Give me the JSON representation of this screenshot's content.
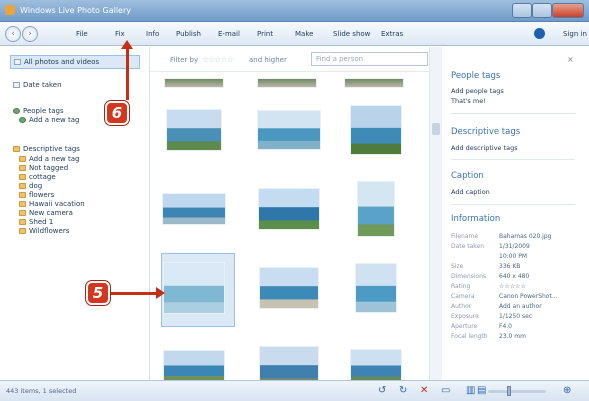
{
  "window": {
    "title": "Windows Live Photo Gallery"
  },
  "toolbar": {
    "menu": [
      "File",
      "Fix",
      "Info",
      "Publish",
      "E-mail",
      "Print",
      "Make",
      "Slide show",
      "Extras"
    ],
    "sign_in": "Sign in"
  },
  "sidebar": {
    "all_photos": "All photos and videos",
    "date_taken": "Date taken",
    "people_tags": "People tags",
    "add_new_tag_people": "Add a new tag",
    "descriptive_tags": "Descriptive tags",
    "descriptive_items": [
      "Add a new tag",
      "Not tagged",
      "cottage",
      "dog",
      "flowers",
      "Hawaii vacation",
      "New camera",
      "Shed 1",
      "Wildflowers"
    ]
  },
  "filter": {
    "label": "Filter by",
    "and_label": "and higher",
    "search_placeholder": "Find a person"
  },
  "thumbnails": [
    {
      "sky": "#c7dcee",
      "sea": "#4a8fb6",
      "land": "#5e8a4d"
    },
    {
      "sky": "#d2e4f2",
      "sea": "#4a97c0",
      "land": "#7fb1c9"
    },
    {
      "sky": "#b9d3ea",
      "sea": "#3f8bb8",
      "land": "#4f7c3c"
    },
    {
      "sky": "#bfd8ee",
      "sea": "#3d86b3",
      "land": "#9bb8c8"
    },
    {
      "sky": "#c4dcef",
      "sea": "#2f77a8",
      "land": "#5b8f49"
    },
    {
      "sky": "#d5e6f3",
      "sea": "#5aa2c8",
      "land": "#6f9a5a"
    },
    {
      "sky": "#d9e9f5",
      "sea": "#7fb8d2",
      "land": "#a9cfe0"
    },
    {
      "sky": "#c8ddef",
      "sea": "#3c8ab8",
      "land": "#c8c2b3"
    },
    {
      "sky": "#cfe2f2",
      "sea": "#4b9bc6",
      "land": "#9ec3d8"
    },
    {
      "sky": "#c2d9ed",
      "sea": "#3a86b6",
      "land": "#6d9159"
    },
    {
      "sky": "#c9dcee",
      "sea": "#417fae",
      "land": "#7a8f69"
    },
    {
      "sky": "#cde0f1",
      "sea": "#3d83b4",
      "land": "#668b54"
    }
  ],
  "panel": {
    "people_tags": "People tags",
    "add_people_tags": "Add people tags",
    "thats_me": "That's me!",
    "descriptive_tags": "Descriptive tags",
    "add_descriptive_tags": "Add descriptive tags",
    "caption": "Caption",
    "add_caption": "Add caption",
    "information": "Information",
    "info": [
      {
        "key": "Filename",
        "value": "Bahamas 020.jpg"
      },
      {
        "key": "Date taken",
        "value": "1/31/2009"
      },
      {
        "key": "",
        "value": "10:00 PM"
      },
      {
        "key": "Size",
        "value": "336 KB"
      },
      {
        "key": "Dimensions",
        "value": "640 x 480"
      },
      {
        "key": "Rating",
        "value": "☆☆☆☆☆"
      },
      {
        "key": "Camera",
        "value": "Canon PowerShot..."
      },
      {
        "key": "Author",
        "value": "Add an author"
      },
      {
        "key": "Exposure",
        "value": "1/1250 sec"
      },
      {
        "key": "Aperture",
        "value": "F4.0"
      },
      {
        "key": "Focal length",
        "value": "23.0 mm"
      }
    ]
  },
  "status": {
    "text": "443 items, 1 selected"
  },
  "callouts": {
    "five": "5",
    "six": "6"
  },
  "colors": {
    "callout": "#d2371f",
    "selection": "#dbe8f6",
    "heading": "#3a73b8"
  }
}
